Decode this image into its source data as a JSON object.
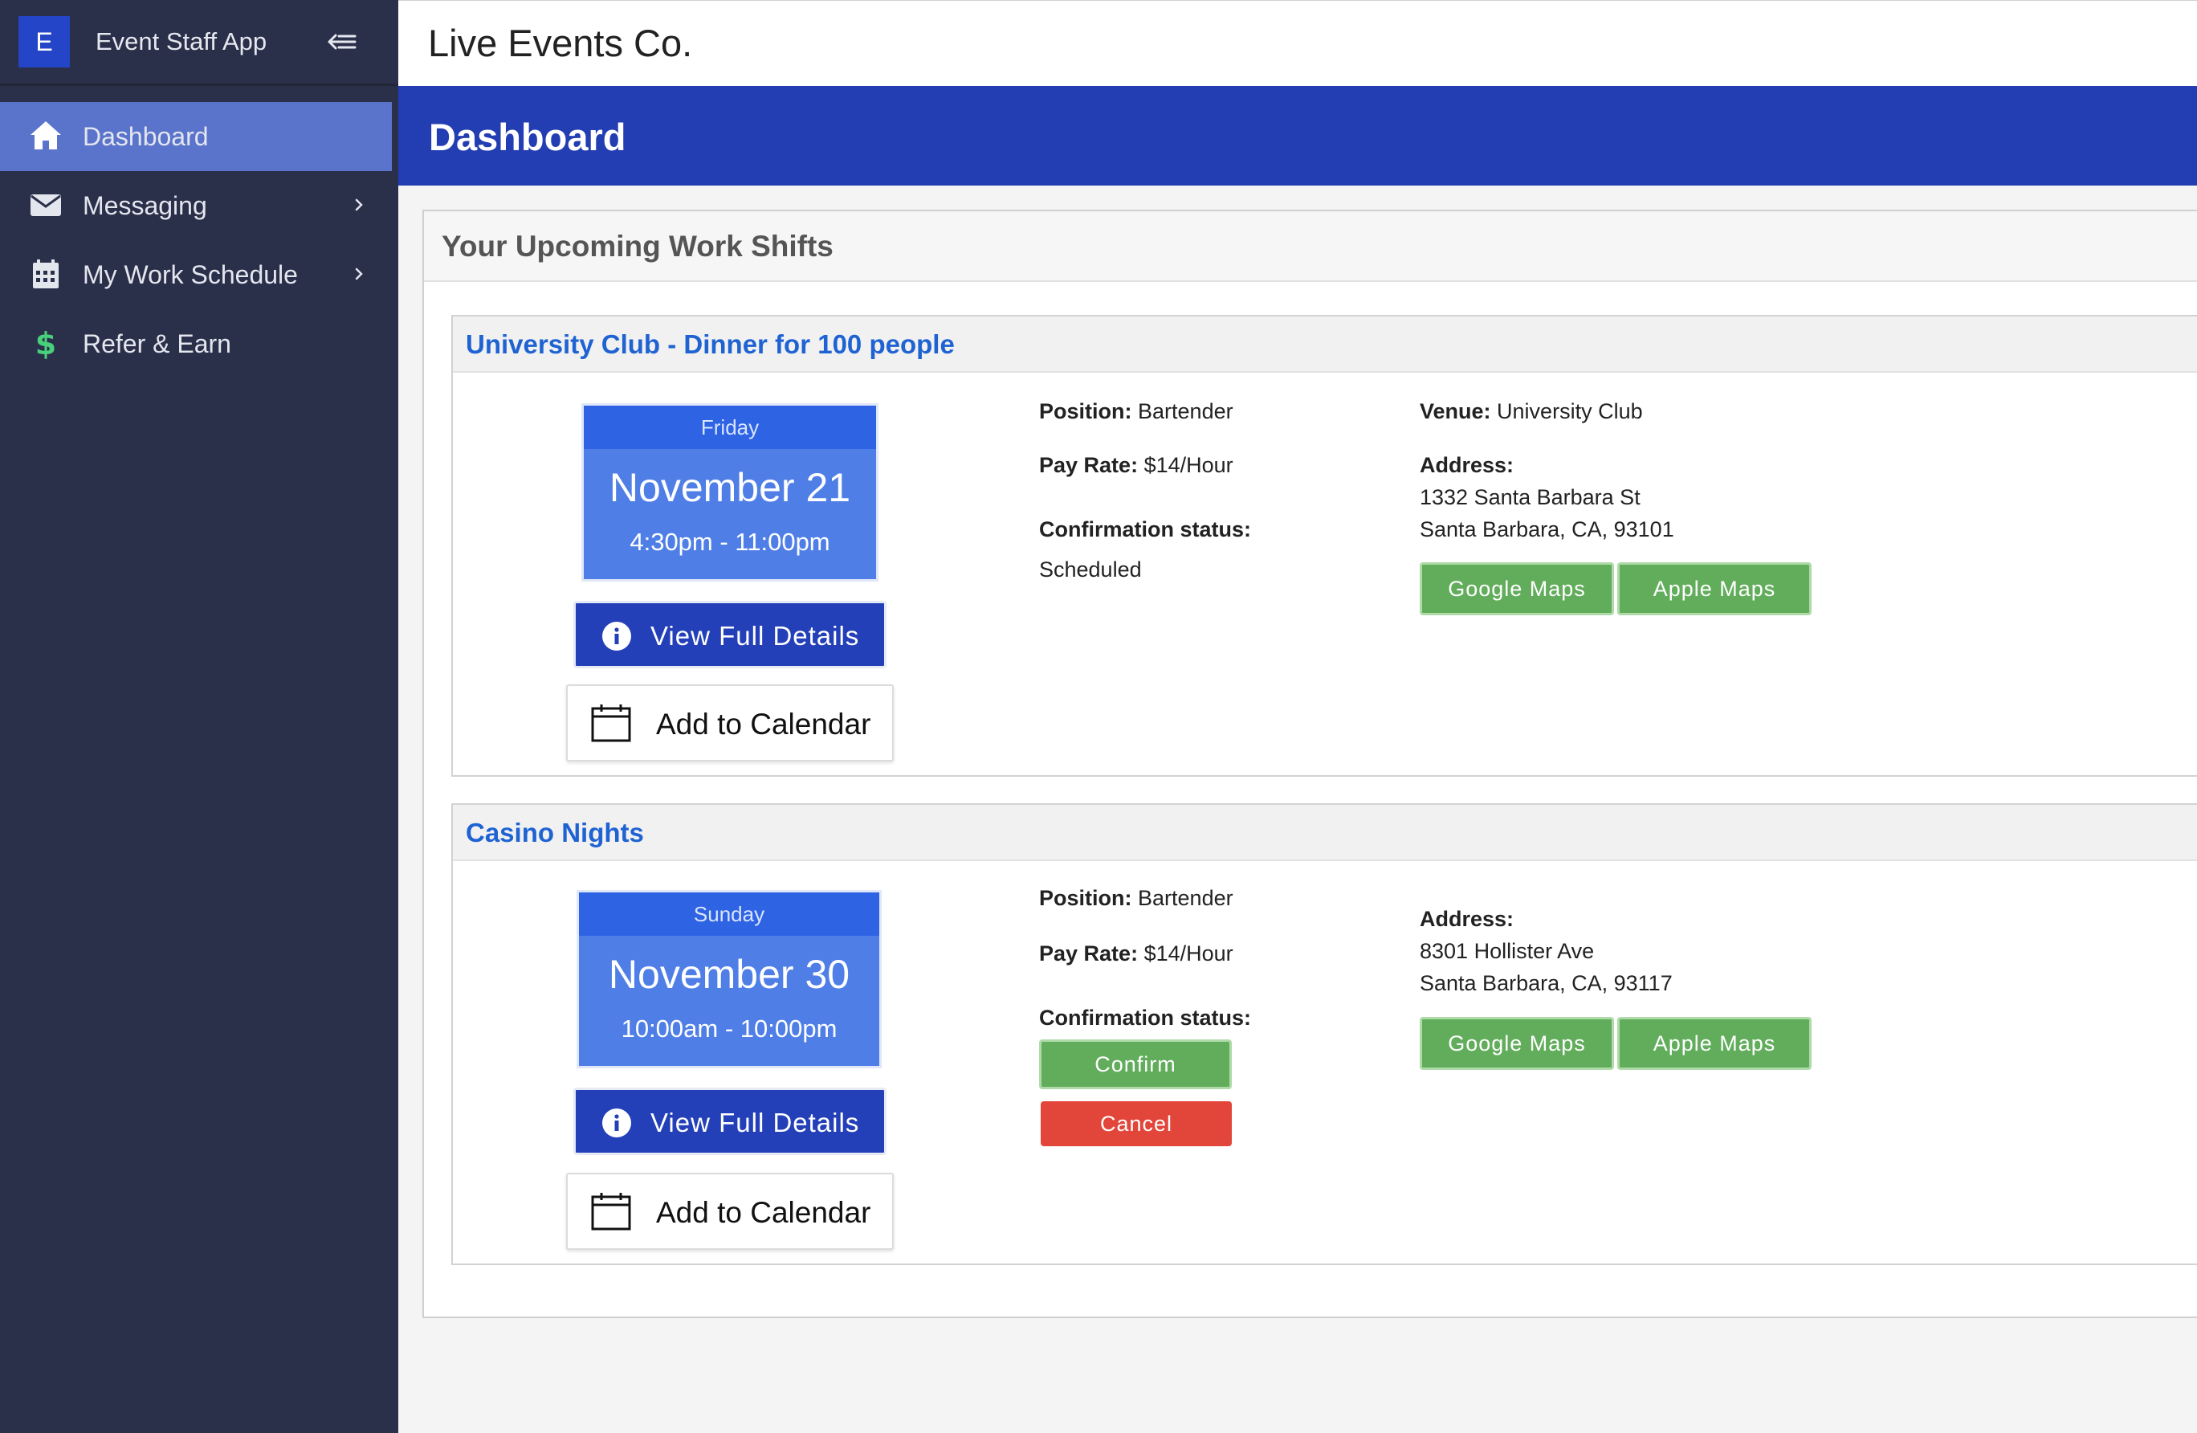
{
  "app": {
    "logo_letter": "E",
    "name": "Event Staff App"
  },
  "sidebar": {
    "items": [
      {
        "label": "Dashboard",
        "icon": "home-icon",
        "active": true,
        "has_submenu": false
      },
      {
        "label": "Messaging",
        "icon": "envelope-icon",
        "active": false,
        "has_submenu": true
      },
      {
        "label": "My Work Schedule",
        "icon": "calendar-icon",
        "active": false,
        "has_submenu": true
      },
      {
        "label": "Refer & Earn",
        "icon": "dollar-icon",
        "active": false,
        "has_submenu": false
      }
    ]
  },
  "header": {
    "company": "Live Events Co."
  },
  "page": {
    "title": "Dashboard"
  },
  "shifts_section": {
    "title": "Your Upcoming Work Shifts",
    "shifts": [
      {
        "title": "University Club - Dinner for 100 people",
        "day": "Friday",
        "date": "November 21",
        "time": "4:30pm - 11:00pm",
        "details_label": "View Full Details",
        "calendar_label": "Add to Calendar",
        "position_label": "Position:",
        "position": "Bartender",
        "pay_label": "Pay Rate:",
        "pay": "$14/Hour",
        "status_label": "Confirmation status:",
        "status": "Scheduled",
        "venue_label": "Venue:",
        "venue": "University Club",
        "address_label": "Address:",
        "address_line1": "1332 Santa Barbara St",
        "address_line2": "Santa Barbara, CA, 93101",
        "google_maps_label": "Google Maps",
        "apple_maps_label": "Apple Maps"
      },
      {
        "title": "Casino Nights",
        "day": "Sunday",
        "date": "November 30",
        "time": "10:00am - 10:00pm",
        "details_label": "View Full Details",
        "calendar_label": "Add to Calendar",
        "position_label": "Position:",
        "position": "Bartender",
        "pay_label": "Pay Rate:",
        "pay": "$14/Hour",
        "status_label": "Confirmation status:",
        "confirm_label": "Confirm",
        "cancel_label": "Cancel",
        "address_label": "Address:",
        "address_line1": "8301 Hollister Ave",
        "address_line2": "Santa Barbara, CA, 93117",
        "google_maps_label": "Google Maps",
        "apple_maps_label": "Apple Maps"
      }
    ]
  },
  "colors": {
    "sidebar_bg": "#2a2f4a",
    "active_nav": "#5a74cc",
    "banner": "#233db2",
    "date_box": "#4f7fe6",
    "shift_title": "#1f63d3",
    "maps_button": "#62ad5c",
    "cancel_button": "#e2463b"
  }
}
